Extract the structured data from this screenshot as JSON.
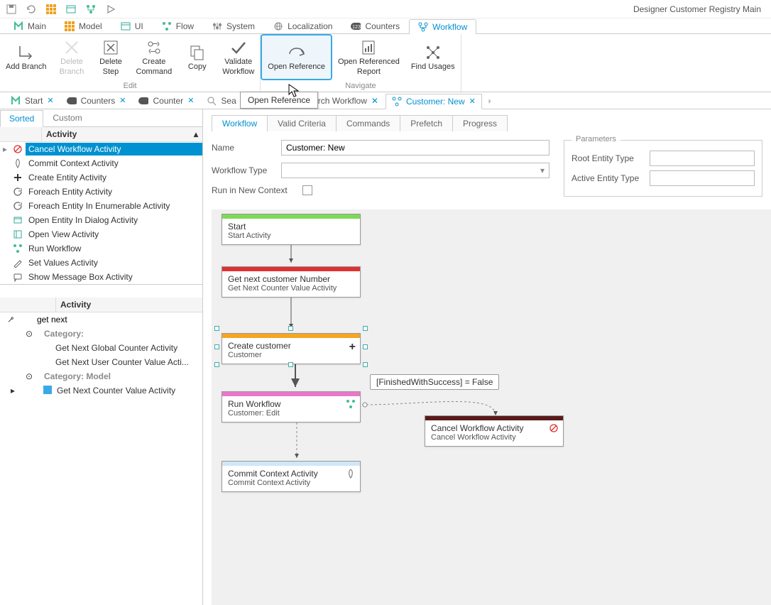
{
  "app_title": "Designer Customer Registry Main",
  "quick_toolbar": {
    "save": "save",
    "refresh": "refresh",
    "grid": "grid",
    "form": "form",
    "flow": "flow",
    "run": "run"
  },
  "ribbon_tabs": [
    {
      "label": "Main"
    },
    {
      "label": "Model"
    },
    {
      "label": "UI"
    },
    {
      "label": "Flow"
    },
    {
      "label": "System"
    },
    {
      "label": "Localization"
    },
    {
      "label": "Counters"
    },
    {
      "label": "Workflow",
      "active": true
    }
  ],
  "ribbon": {
    "edit_group": "Edit",
    "navigate_group": "Navigate",
    "buttons": {
      "add_branch": "Add Branch",
      "delete_branch": "Delete\nBranch",
      "delete_step": "Delete\nStep",
      "create_command": "Create\nCommand",
      "copy": "Copy",
      "validate_workflow": "Validate\nWorkflow",
      "open_reference": "Open Reference",
      "open_referenced_report": "Open Referenced\nReport",
      "find_usages": "Find Usages"
    }
  },
  "tooltip": "Open Reference",
  "doc_tabs": [
    {
      "label": "Start"
    },
    {
      "label": "Counters"
    },
    {
      "label": "Counter"
    },
    {
      "label": "Search Workflow",
      "search": true
    },
    {
      "label": "Customer: New",
      "active": true
    }
  ],
  "side_tabs": {
    "sorted": "Sorted",
    "custom": "Custom"
  },
  "activity_header": "Activity",
  "activities": [
    {
      "label": "Cancel Workflow Activity",
      "selected": true,
      "icon": "cancel"
    },
    {
      "label": "Commit Context Activity",
      "icon": "rocket"
    },
    {
      "label": "Create Entity Activity",
      "icon": "plus"
    },
    {
      "label": "Foreach Entity Activity",
      "icon": "loop"
    },
    {
      "label": "Foreach Entity In Enumerable Activity",
      "icon": "loop"
    },
    {
      "label": "Open Entity In Dialog Activity",
      "icon": "dialog"
    },
    {
      "label": "Open View Activity",
      "icon": "view"
    },
    {
      "label": "Run Workflow",
      "icon": "flow"
    },
    {
      "label": "Set Values Activity",
      "icon": "edit"
    },
    {
      "label": "Show Message Box  Activity",
      "icon": "message"
    }
  ],
  "filter": {
    "header": "Activity",
    "value": "get next",
    "cat1": "Category:",
    "items1": [
      "Get Next Global Counter Activity",
      "Get Next User Counter Value Acti..."
    ],
    "cat2": "Category: Model",
    "items2": [
      "Get Next Counter Value Activity"
    ]
  },
  "editor_tabs": [
    "Workflow",
    "Valid Criteria",
    "Commands",
    "Prefetch",
    "Progress"
  ],
  "form": {
    "name_label": "Name",
    "name_value": "Customer: New",
    "type_label": "Workflow Type",
    "run_new_label": "Run in New Context"
  },
  "params": {
    "legend": "Parameters",
    "root": "Root Entity Type",
    "active": "Active Entity Type"
  },
  "nodes": {
    "start": {
      "title": "Start",
      "sub": "Start Activity"
    },
    "getnext": {
      "title": "Get next customer Number",
      "sub": "Get Next Counter Value Activity"
    },
    "create": {
      "title": "Create customer",
      "sub": "Customer"
    },
    "run": {
      "title": "Run Workflow",
      "sub": "Customer: Edit"
    },
    "commit": {
      "title": "Commit Context Activity",
      "sub": "Commit Context Activity"
    },
    "cancel": {
      "title": "Cancel Workflow Activity",
      "sub": "Cancel Workflow Activity"
    }
  },
  "condition": "[FinishedWithSuccess] = False"
}
